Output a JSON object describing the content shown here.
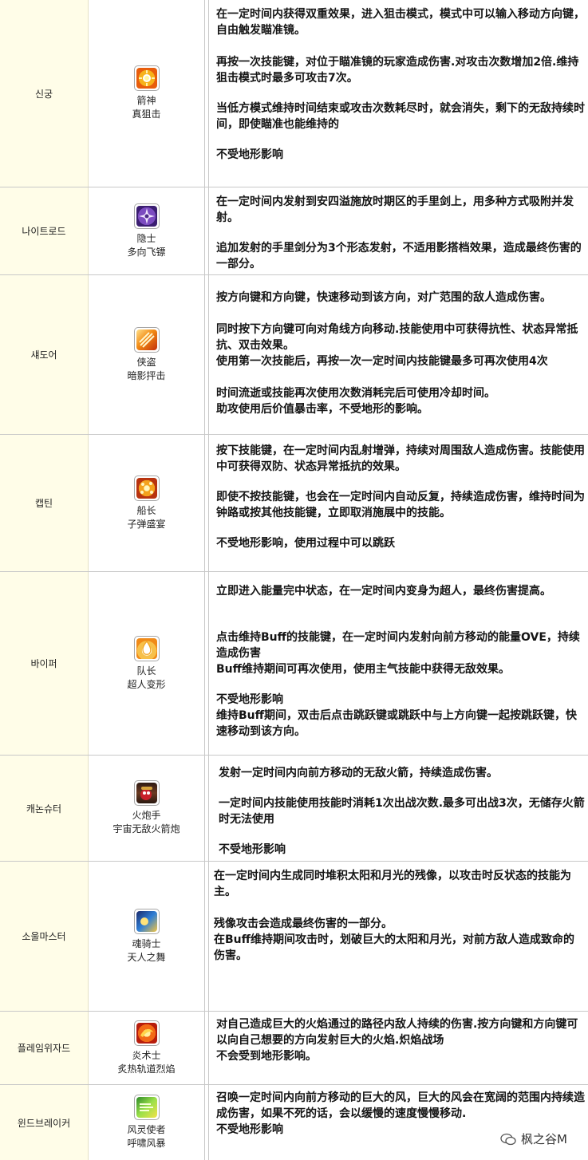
{
  "rows": [
    {
      "job": "신궁",
      "skill_l1": "箭神",
      "skill_l2": "真狙击",
      "icon": "sun-emblem-icon",
      "paras": [
        "在一定时间内获得双重效果，进入狙击模式，模式中可以输入移动方向键，自由触发瞄准镜。",
        "再按一次技能键，对位于瞄准镜的玩家造成伤害.对攻击次数增加2倍.维持狙击模式时最多可攻击7次。",
        "当低方模式维持时间结束或攻击次数耗尽时，就会消失，剩下的无敌持续时间，即使瞄准也能维持的",
        "不受地形影响"
      ]
    },
    {
      "job": "나이트로드",
      "skill_l1": "隐士",
      "skill_l2": "多向飞镖",
      "icon": "shuriken-icon",
      "paras": [
        "在一定时间内发射到安四溢施放时期区的手里剑上，用多种方式吸附并发射。",
        "追加发射的手里剑分为3个形态发射，不适用影搭档效果，造成最终伤害的一部分。"
      ]
    },
    {
      "job": "섀도어",
      "skill_l1": "侠盗",
      "skill_l2": "暗影抨击",
      "icon": "shadow-strike-icon",
      "paras": [
        "按方向键和方向键，快速移动到该方向，对广范围的敌人造成伤害。",
        "同时按下方向键可向对角线方向移动.技能使用中可获得抗性、状态异常抵抗、双击效果。",
        "使用第一次技能后，再按一次一定时间内技能键最多可再次使用4次",
        "时间流逝或技能再次使用次数消耗完后可使用冷却时间。",
        "助攻使用后价值暴击率，不受地形的影响。"
      ]
    },
    {
      "job": "캡틴",
      "skill_l1": "船长",
      "skill_l2": "子弹盛宴",
      "icon": "bullet-burst-icon",
      "paras": [
        "按下技能键，在一定时间内乱射增弹，持续对周围敌人造成伤害。技能使用中可获得双防、状态异常抵抗的效果。",
        "即使不按技能键，也会在一定时间内自动反复，持续造成伤害，维持时间为钟路或按其他技能键，立即取消施展中的技能。",
        "不受地形影响，使用过程中可以跳跃"
      ]
    },
    {
      "job": "바이퍼",
      "skill_l1": "队长",
      "skill_l2": "超人变形",
      "icon": "flame-fist-icon",
      "paras": [
        "立即进入能量完中状态，在一定时间内变身为超人，最终伤害提高。",
        "点击维持Buff的技能键，在一定时间内发射向前方移动的能量OVE，持续造成伤害",
        "Buff维持期间可再次使用，使用主气技能中获得无敌效果。",
        "不受地形影响",
        "维持Buff期间，双击后点击跳跃键或跳跃中与上方向键一起按跳跃键，快速移动到该方向。"
      ]
    },
    {
      "job": "캐논슈터",
      "skill_l1": "火炮手",
      "skill_l2": "宇宙无敌火箭炮",
      "icon": "cannon-icon",
      "paras": [
        "发射一定时间内向前方移动的无敌火箭，持续造成伤害。",
        "一定时间内技能使用技能时消耗1次出战次数.最多可出战3次，无储存火箭时无法使用",
        "不受地形影响"
      ]
    },
    {
      "job": "소울마스터",
      "skill_l1": "魂骑士",
      "skill_l2": "天人之舞",
      "icon": "sun-moon-icon",
      "paras": [
        "在一定时间内生成同时堆积太阳和月光的残像，以攻击时反状态的技能为主。",
        "残像攻击会造成最终伤害的一部分。",
        "在Buff维持期间攻击时，划破巨大的太阳和月光，对前方敌人造成致命的伤害。"
      ]
    },
    {
      "job": "플레임위자드",
      "skill_l1": "炎术士",
      "skill_l2": "炙热轨道烈焰",
      "icon": "fire-orbit-icon",
      "paras": [
        "对自己造成巨大的火焰通过的路径内敌人持续的伤害.按方向键和方向键可以向自己想要的方向发射巨大的火焰.炽焰战场",
        "不会受到地形影响。"
      ]
    },
    {
      "job": "윈드브레이커",
      "skill_l1": "风灵使者",
      "skill_l2": "呼啸风暴",
      "icon": "wind-storm-icon",
      "paras": [
        "召唤一定时间内向前方移动的巨大的风，巨大的风会在宽阔的范围内持续造成伤害，如果不死的话，会以缓慢的速度慢慢移动.",
        "不受地形影响"
      ]
    }
  ],
  "watermark": {
    "text": "枫之谷M",
    "icon": "wechat-logo-icon"
  }
}
